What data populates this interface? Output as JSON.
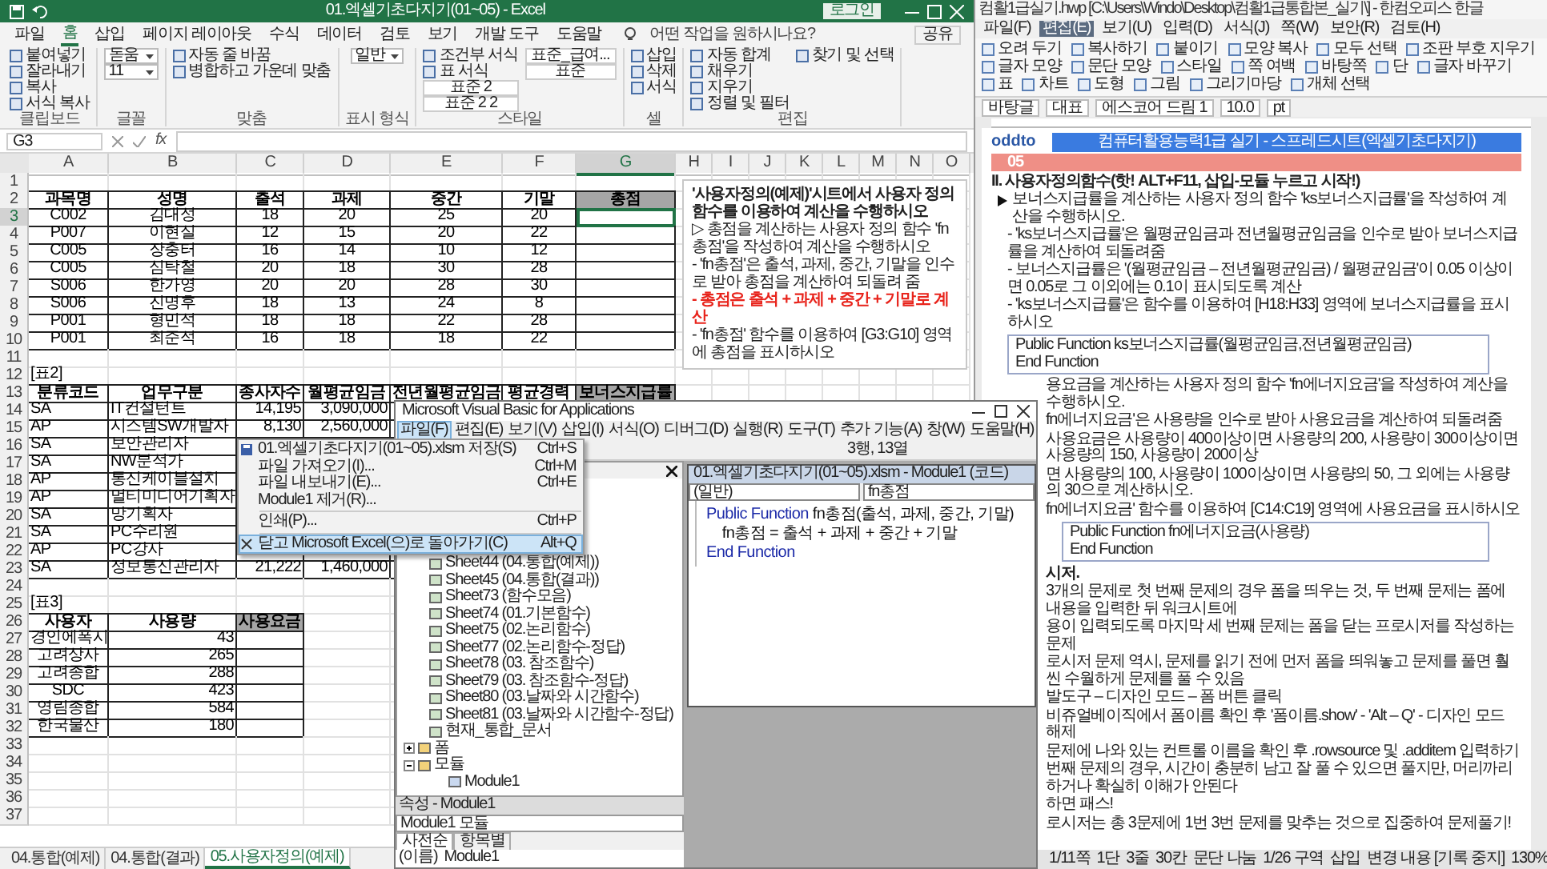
{
  "excel": {
    "title": "01.엑셀기초다지기(01~05) - Excel",
    "login": "로그인",
    "tabs": [
      {
        "label": "파일",
        "selected": false
      },
      {
        "label": "홈",
        "selected": true
      },
      {
        "label": "삽입",
        "selected": false
      },
      {
        "label": "페이지 레이아웃",
        "selected": false
      },
      {
        "label": "수식",
        "selected": false
      },
      {
        "label": "데이터",
        "selected": false
      },
      {
        "label": "검토",
        "selected": false
      },
      {
        "label": "보기",
        "selected": false
      },
      {
        "label": "개발 도구",
        "selected": false
      },
      {
        "label": "도움말",
        "selected": false
      }
    ],
    "tell_me": "어떤 작업을 원하시나요?",
    "share": "공유",
    "ribbon": [
      {
        "label": "클립보드",
        "items": [
          {
            "kind": "button",
            "label": "붙여넣기"
          },
          {
            "kind": "button",
            "label": "잘라내기"
          },
          {
            "kind": "button",
            "label": "복사"
          },
          {
            "kind": "button",
            "label": "서식 복사"
          }
        ]
      },
      {
        "label": "글꼴",
        "items": [
          {
            "kind": "field",
            "label": "돋움"
          },
          {
            "kind": "field",
            "label": "11"
          }
        ]
      },
      {
        "label": "맞춤",
        "items": [
          {
            "kind": "button",
            "label": "자동 줄 바꿈"
          },
          {
            "kind": "button",
            "label": "병합하고 가운데 맞춤"
          }
        ]
      },
      {
        "label": "표시 형식",
        "items": [
          {
            "kind": "field",
            "label": "일반"
          }
        ]
      },
      {
        "label": "스타일",
        "items": [
          {
            "kind": "button",
            "label": "조건부 서식"
          },
          {
            "kind": "button",
            "label": "표 서식"
          },
          {
            "kind": "style",
            "label": "표준 2"
          },
          {
            "kind": "style",
            "label": "표준 2 2"
          },
          {
            "kind": "style",
            "label": "표준_급여..."
          },
          {
            "kind": "style",
            "label": "표준"
          }
        ]
      },
      {
        "label": "셀",
        "items": [
          {
            "kind": "button",
            "label": "삽입"
          },
          {
            "kind": "button",
            "label": "삭제"
          },
          {
            "kind": "button",
            "label": "서식"
          }
        ]
      },
      {
        "label": "편집",
        "items": [
          {
            "kind": "button",
            "label": "자동 합계"
          },
          {
            "kind": "button",
            "label": "채우기"
          },
          {
            "kind": "button",
            "label": "지우기"
          },
          {
            "kind": "button",
            "label": "정렬 및 필터"
          },
          {
            "kind": "button",
            "label": "찾기 및 선택"
          }
        ]
      }
    ],
    "name_box": "G3",
    "fx": "fx",
    "columns": [
      {
        "label": "A",
        "selected": false
      },
      {
        "label": "B",
        "selected": false
      },
      {
        "label": "C",
        "selected": false
      },
      {
        "label": "D",
        "selected": false
      },
      {
        "label": "E",
        "selected": false
      },
      {
        "label": "F",
        "selected": false
      },
      {
        "label": "G",
        "selected": true
      },
      {
        "label": "H",
        "selected": false
      },
      {
        "label": "I",
        "selected": false
      },
      {
        "label": "J",
        "selected": false
      },
      {
        "label": "K",
        "selected": false
      },
      {
        "label": "L",
        "selected": false
      },
      {
        "label": "M",
        "selected": false
      },
      {
        "label": "N",
        "selected": false
      },
      {
        "label": "O",
        "selected": false
      }
    ],
    "rows": [
      {
        "num": "1",
        "kind": "blank",
        "selected": false
      },
      {
        "num": "2",
        "kind": "header",
        "selected": false,
        "cells": [
          {
            "text": "과목명",
            "shaded": false
          },
          {
            "text": "성명",
            "shaded": false
          },
          {
            "text": "출석",
            "shaded": false
          },
          {
            "text": "과제",
            "shaded": false
          },
          {
            "text": "중간",
            "shaded": false
          },
          {
            "text": "기말",
            "shaded": false
          },
          {
            "text": "총점",
            "shaded": true
          }
        ]
      },
      {
        "num": "3",
        "kind": "record_center",
        "selected": true,
        "cells": [
          "C002",
          "김대성",
          "18",
          "20",
          "25",
          "20",
          null
        ]
      },
      {
        "num": "4",
        "kind": "record_center",
        "selected": false,
        "cells": [
          "P007",
          "이현실",
          "12",
          "15",
          "20",
          "22",
          null
        ]
      },
      {
        "num": "5",
        "kind": "record_center",
        "selected": false,
        "cells": [
          "C005",
          "장충터",
          "16",
          "14",
          "10",
          "12",
          null
        ]
      },
      {
        "num": "6",
        "kind": "record_center",
        "selected": false,
        "cells": [
          "C005",
          "심탁철",
          "20",
          "18",
          "30",
          "28",
          null
        ]
      },
      {
        "num": "7",
        "kind": "record_center",
        "selected": false,
        "cells": [
          "S006",
          "한가영",
          "20",
          "20",
          "28",
          "30",
          null
        ]
      },
      {
        "num": "8",
        "kind": "record_center",
        "selected": false,
        "cells": [
          "S006",
          "진명후",
          "18",
          "13",
          "24",
          "8",
          null
        ]
      },
      {
        "num": "9",
        "kind": "record_center",
        "selected": false,
        "cells": [
          "P001",
          "형민석",
          "18",
          "18",
          "22",
          "28",
          null
        ]
      },
      {
        "num": "10",
        "kind": "record_center",
        "selected": false,
        "cells": [
          "P001",
          "최준석",
          "16",
          "18",
          "18",
          "22",
          null
        ]
      },
      {
        "num": "11",
        "kind": "blank",
        "selected": false
      },
      {
        "num": "12",
        "kind": "caption",
        "selected": false,
        "cells": [
          "[표2]"
        ]
      },
      {
        "num": "13",
        "kind": "header",
        "selected": false,
        "cells": [
          {
            "text": "분류코드",
            "shaded": false
          },
          {
            "text": "업무구분",
            "shaded": false
          },
          {
            "text": "종사자수",
            "shaded": false
          },
          {
            "text": "월평균임금",
            "shaded": false
          },
          {
            "text": "전년월평균임금",
            "shaded": false
          },
          {
            "text": "평균경력",
            "shaded": false
          },
          {
            "text": "보너스지급률",
            "shaded": true
          }
        ]
      },
      {
        "num": "14",
        "kind": "record_code",
        "selected": false,
        "cells": [
          "SA",
          "IT컨설턴트",
          "14,195",
          "3,090,000",
          null,
          null,
          null
        ]
      },
      {
        "num": "15",
        "kind": "record_code",
        "selected": false,
        "cells": [
          "AP",
          "시스템SW개발자",
          "8,130",
          "2,560,000",
          null,
          null,
          null
        ]
      },
      {
        "num": "16",
        "kind": "record_code",
        "selected": false,
        "cells": [
          "SA",
          "보안관리자",
          null,
          null,
          null,
          null,
          null
        ]
      },
      {
        "num": "17",
        "kind": "record_code",
        "selected": false,
        "cells": [
          "SA",
          "NW분석가",
          null,
          null,
          null,
          null,
          null
        ]
      },
      {
        "num": "18",
        "kind": "record_code",
        "selected": false,
        "cells": [
          "AP",
          "통신케이블설치",
          null,
          null,
          null,
          null,
          null
        ]
      },
      {
        "num": "19",
        "kind": "record_code",
        "selected": false,
        "cells": [
          "AP",
          "멀티미디어기획자",
          null,
          null,
          null,
          null,
          null
        ]
      },
      {
        "num": "20",
        "kind": "record_code",
        "selected": false,
        "cells": [
          "SA",
          "망기획자",
          null,
          null,
          null,
          null,
          null
        ]
      },
      {
        "num": "21",
        "kind": "record_code",
        "selected": false,
        "cells": [
          "SA",
          "PC수리원",
          null,
          null,
          null,
          null,
          null
        ]
      },
      {
        "num": "22",
        "kind": "record_code",
        "selected": false,
        "cells": [
          "AP",
          "PC강사",
          null,
          null,
          null,
          null,
          null
        ]
      },
      {
        "num": "23",
        "kind": "record_code",
        "selected": false,
        "cells": [
          "SA",
          "정보통신관리자",
          "21,222",
          "1,460,000",
          null,
          null,
          null
        ]
      },
      {
        "num": "24",
        "kind": "blank",
        "selected": false
      },
      {
        "num": "25",
        "kind": "caption",
        "selected": false,
        "cells": [
          "[표3]"
        ]
      },
      {
        "num": "26",
        "kind": "header",
        "selected": false,
        "cells": [
          {
            "text": "사용자",
            "shaded": false
          },
          {
            "text": "사용량",
            "shaded": false
          },
          {
            "text": "사용요금",
            "shaded": true
          }
        ]
      },
      {
        "num": "27",
        "kind": "record_user",
        "selected": false,
        "cells": [
          "경인에폭시",
          "43",
          null
        ]
      },
      {
        "num": "28",
        "kind": "record_user",
        "selected": false,
        "cells": [
          "고려상사",
          "265",
          null
        ]
      },
      {
        "num": "29",
        "kind": "record_user",
        "selected": false,
        "cells": [
          "고려종합",
          "288",
          null
        ]
      },
      {
        "num": "30",
        "kind": "record_user",
        "selected": false,
        "cells": [
          "SDC",
          "423",
          null
        ]
      },
      {
        "num": "31",
        "kind": "record_user",
        "selected": false,
        "cells": [
          "영림종합",
          "584",
          null
        ]
      },
      {
        "num": "32",
        "kind": "record_user",
        "selected": false,
        "cells": [
          "한국물산",
          "180",
          null
        ]
      },
      {
        "num": "33",
        "kind": "blank",
        "selected": false
      },
      {
        "num": "34",
        "kind": "blank",
        "selected": false
      },
      {
        "num": "35",
        "kind": "blank",
        "selected": false
      },
      {
        "num": "36",
        "kind": "blank",
        "selected": false
      },
      {
        "num": "37",
        "kind": "blank",
        "selected": false
      }
    ],
    "notes": [
      {
        "kind": "title",
        "text": "'사용자정의(예제)'시트에서 사용자 정의 함수를 이용하여 계산을 수행하시오"
      },
      {
        "kind": "text",
        "text": "▷ 총점을 계산하는 사용자 정의 함수 'fn총점'을 작성하여 계산을 수행하시오"
      },
      {
        "kind": "text",
        "text": "- 'fn총점'은 출석, 과제, 중간, 기말을 인수로 받아 총점을 계산하여 되돌려 줌"
      },
      {
        "kind": "alert",
        "text": "- 총점은 출석 + 과제 + 중간 + 기말로 계산"
      },
      {
        "kind": "text",
        "text": "- 'fn총점' 함수를 이용하여 [G3:G10] 영역에 총점을 표시하시오"
      }
    ],
    "sheet_tabs": [
      {
        "label": "04.통합(예제)",
        "selected": false
      },
      {
        "label": "04.통합(결과)",
        "selected": false
      },
      {
        "label": "05.사용자정의(예제)",
        "selected": true
      }
    ]
  },
  "file_menu": [
    {
      "kind": "item",
      "label": "01.엑셀기초다지기(01~05).xlsm 저장(S)",
      "shortcut": "Ctrl+S",
      "selected": false
    },
    {
      "kind": "item",
      "label": "파일 가져오기(I)...",
      "shortcut": "Ctrl+M",
      "selected": false
    },
    {
      "kind": "item",
      "label": "파일 내보내기(E)...",
      "shortcut": "Ctrl+E",
      "selected": false
    },
    {
      "kind": "item",
      "label": "Module1 제거(R)...",
      "selected": false
    },
    {
      "kind": "separator"
    },
    {
      "kind": "item",
      "label": "인쇄(P)...",
      "shortcut": "Ctrl+P",
      "selected": false
    },
    {
      "kind": "separator"
    },
    {
      "kind": "item",
      "label": "닫고 Microsoft Excel(으)로 돌아가기(C)",
      "shortcut": "Alt+Q",
      "selected": true
    }
  ],
  "vba": {
    "title": "Microsoft Visual Basic for Applications",
    "menu": [
      {
        "label": "파일(F)",
        "selected": true
      },
      {
        "label": "편집(E)",
        "selected": false
      },
      {
        "label": "보기(V)",
        "selected": false
      },
      {
        "label": "삽입(I)",
        "selected": false
      },
      {
        "label": "서식(O)",
        "selected": false
      },
      {
        "label": "디버그(D)",
        "selected": false
      },
      {
        "label": "실행(R)",
        "selected": false
      },
      {
        "label": "도구(T)",
        "selected": false
      },
      {
        "label": "추가 기능(A)",
        "selected": false
      },
      {
        "label": "창(W)",
        "selected": false
      },
      {
        "label": "도움말(H)",
        "selected": false
      }
    ],
    "position": "3행, 13열",
    "tree": [
      {
        "kind": "sheet",
        "label": "Sheet44 (04.통합(예제))"
      },
      {
        "kind": "sheet",
        "label": "Sheet45 (04.통합(결과))"
      },
      {
        "kind": "sheet",
        "label": "Sheet73 (함수모음)"
      },
      {
        "kind": "sheet",
        "label": "Sheet74 (01.기본함수)"
      },
      {
        "kind": "sheet",
        "label": "Sheet75 (02.논리함수)"
      },
      {
        "kind": "sheet",
        "label": "Sheet77 (02.논리함수-정답)"
      },
      {
        "kind": "sheet",
        "label": "Sheet78 (03. 참조함수)"
      },
      {
        "kind": "sheet",
        "label": "Sheet79 (03. 참조함수-정답)"
      },
      {
        "kind": "sheet",
        "label": "Sheet80 (03.날짜와 시간함수)"
      },
      {
        "kind": "sheet",
        "label": "Sheet81 (03.날짜와 시간함수-정답)"
      },
      {
        "kind": "workbook",
        "label": "현재_통합_문서"
      },
      {
        "kind": "folder",
        "label": "폼",
        "expanded": false
      },
      {
        "kind": "folder",
        "label": "모듈",
        "expanded": true,
        "children": [
          {
            "kind": "module",
            "label": "Module1"
          }
        ]
      }
    ],
    "properties": {
      "title": "속성 - Module1",
      "object": "Module1 모듈",
      "tabs": [
        {
          "label": "사전순",
          "selected": true
        },
        {
          "label": "항목별",
          "selected": false
        }
      ],
      "rows": [
        {
          "name": "(이름)",
          "value": "Module1"
        }
      ]
    },
    "code": {
      "title": "01.엑셀기초다지기(01~05).xlsm - Module1 (코드)",
      "object": "(일반)",
      "procedure": "fn총점",
      "lines": [
        [
          {
            "kind": "keyword",
            "text": "Public Function"
          },
          {
            "kind": "plain",
            "text": " fn총점(출석, 과제, 중간, 기말)"
          }
        ],
        [
          {
            "kind": "plain",
            "text": "    fn총점 = 출석 + 과제 + 중간 + 기말"
          }
        ],
        [
          {
            "kind": "keyword",
            "text": "End Function"
          }
        ]
      ]
    }
  },
  "doc": {
    "title": "컴활1급실기.hwp [C:\\Users\\Windo\\Desktop\\컴활1급통합본_실기\\] - 한컴오피스 한글",
    "menu": [
      {
        "label": "파일(F)",
        "selected": false
      },
      {
        "label": "편집(E)",
        "selected": true
      },
      {
        "label": "보기(U)",
        "selected": false
      },
      {
        "label": "입력(D)",
        "selected": false
      },
      {
        "label": "서식(J)",
        "selected": false
      },
      {
        "label": "쪽(W)",
        "selected": false
      },
      {
        "label": "보안(R)",
        "selected": false
      },
      {
        "label": "검토(H)",
        "selected": false
      }
    ],
    "ribbon": [
      "오려 두기",
      "복사하기",
      "붙이기",
      "모양 복사",
      "모두 선택",
      "조판 부호 지우기",
      "글자 모양",
      "문단 모양",
      "스타일",
      "쪽 여백",
      "바탕쪽",
      "단",
      "글자 바꾸기",
      "표",
      "차트",
      "도형",
      "그림",
      "그리기마당",
      "개체 선택"
    ],
    "toolbar": [
      "바탕글",
      "대표",
      "에스코어 드림 1",
      "10.0",
      "pt"
    ],
    "logo": "oddto",
    "banner": "컴퓨터활용능력1급 실기 - 스프레드시트(엑셀기초다지기)",
    "blocks": [
      {
        "kind": "section",
        "text": "05"
      },
      {
        "kind": "heading",
        "text": "II. 사용자정의함수(핫! ALT+F11, 삽입-모듈 누르고 시작!)"
      },
      {
        "kind": "bullet",
        "text": "보너스지급률을 계산하는 사용자 정의 함수 'ks보너스지급률'을 작성하여 계산을 수행하시오."
      },
      {
        "kind": "text",
        "text": "- 'ks보너스지급률'은 월평균임금과 전년월평균임금을 인수로 받아 보너스지급률을 계산하여 되돌려줌"
      },
      {
        "kind": "text",
        "text": "- 보너스지급률은 '(월평균임금 – 전년월평균임금) / 월평균임금'이 0.05 이상이면 0.05로 그 이외에는 0.1이 표시되도록 계산"
      },
      {
        "kind": "text",
        "text": "- 'ks보너스지급률'은 함수를 이용하여 [H18:H33] 영역에 보너스지급률을 표시하시오"
      },
      {
        "kind": "code",
        "lines": [
          "Public Function ks보너스지급률(월평균임금,전년월평균임금)",
          "End Function"
        ]
      }
    ],
    "cut_blocks": [
      {
        "kind": "text",
        "text": "용요금을 계산하는 사용자 정의 함수 'fn에너지요금'을 작성하여 계산을 수행하시오."
      },
      {
        "kind": "text",
        "text": "fn에너지요금'은 사용량을 인수로 받아 사용요금을 계산하여 되돌려줌"
      },
      {
        "kind": "text",
        "text": "사용요금은 사용량이 400이상이면 사용량의 200, 사용량이 300이상이면 사용량의 150, 사용량이 200이상"
      },
      {
        "kind": "text",
        "text": "면 사용량의 100, 사용량이 100이상이면 사용량의 50, 그 외에는 사용량의 30으로 계산하시오."
      },
      {
        "kind": "text",
        "text": "fn에너지요금' 함수를 이용하여 [C14:C19] 영역에 사용요금을 표시하시오"
      },
      {
        "kind": "code",
        "lines": [
          "Public Function fn에너지요금(사용량)",
          "End Function"
        ]
      },
      {
        "kind": "heading",
        "text": "시저."
      },
      {
        "kind": "text",
        "text": "3개의 문제로 첫 번째 문제의 경우 폼을 띄우는 것, 두 번째 문제는 폼에 내용을 입력한 뒤 워크시트에"
      },
      {
        "kind": "text",
        "text": "용이 입력되도록 마지막 세 번째 문제는 폼을 닫는 프로시저를 작성하는 문제"
      },
      {
        "kind": "text",
        "text": "로시저 문제 역시, 문제를 읽기 전에 먼저 폼을 띄워놓고 문제를 풀면 훨씬 수월하게 문제를 풀 수 있음"
      },
      {
        "kind": "text",
        "text": "발도구 – 디자인 모드 – 폼 버튼 클릭"
      },
      {
        "kind": "text",
        "text": "비쥬얼베이직에서 폼이름 확인 후 '폼이름.show' - 'Alt – Q' - 디자인 모드 해제"
      },
      {
        "kind": "text",
        "text": "문제에 나와 있는 컨트롤 이름을 확인 후 .rowsource 및 .additem 입력하기"
      },
      {
        "kind": "text",
        "text": "번째 문제의 경우, 시간이 충분히 남고 잘 풀 수 있으면 풀지만, 머리까리 하거나 확실히 이해가 안된다"
      },
      {
        "kind": "text",
        "text": "하면 패스!"
      },
      {
        "kind": "text",
        "text": "로시저는 총 3문제에 1번 3번 문제를 맞추는 것으로 집중하여 문제풀기!"
      }
    ],
    "status": [
      "1/11쪽",
      "1단",
      "3줄",
      "30칸",
      "문단 나눔",
      "1/26 구역",
      "삽입",
      "변경 내용 [기록 중지]",
      "130%"
    ]
  }
}
